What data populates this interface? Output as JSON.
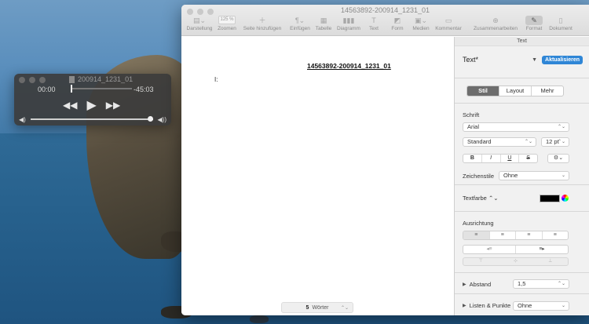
{
  "quicktime": {
    "title": "200914_1231_01",
    "time_current": "00:00",
    "time_remaining": "-45:03",
    "progress": 0.0,
    "volume": 1.0
  },
  "pages": {
    "window_title": "14563892-200914_1231_01",
    "toolbar": {
      "darstellung": "Darstellung",
      "zoom_value": "125 %",
      "zoomen": "Zoomen",
      "seite_hinzufuegen": "Seite hinzufügen",
      "einfuegen": "Einfügen",
      "tabelle": "Tabelle",
      "diagramm": "Diagramm",
      "text": "Text",
      "form": "Form",
      "medien": "Medien",
      "kommentar": "Kommentar",
      "zusammenarbeiten": "Zusammenarbeiten",
      "format": "Format",
      "dokument": "Dokument"
    },
    "document": {
      "heading": "14563892-200914_1231_01",
      "line1": "I:",
      "word_count_number": "5",
      "word_count_label": "Wörter"
    },
    "inspector": {
      "tab_label": "Text",
      "style_name": "Text*",
      "update_button": "Aktualisieren",
      "segments": [
        "Stil",
        "Layout",
        "Mehr"
      ],
      "schrift_label": "Schrift",
      "font_name": "Arial",
      "font_style": "Standard",
      "font_size": "12 pt",
      "format_buttons": [
        "B",
        "I",
        "U",
        "S"
      ],
      "gear": "⚙",
      "zeichenstile_label": "Zeichenstile",
      "zeichenstile_value": "Ohne",
      "textfarbe_label": "Textfarbe",
      "textfarbe_color": "#000000",
      "ausrichtung_label": "Ausrichtung",
      "abstand_label": "Abstand",
      "abstand_value": "1,5",
      "listen_label": "Listen & Punkte",
      "listen_value": "Ohne"
    }
  }
}
